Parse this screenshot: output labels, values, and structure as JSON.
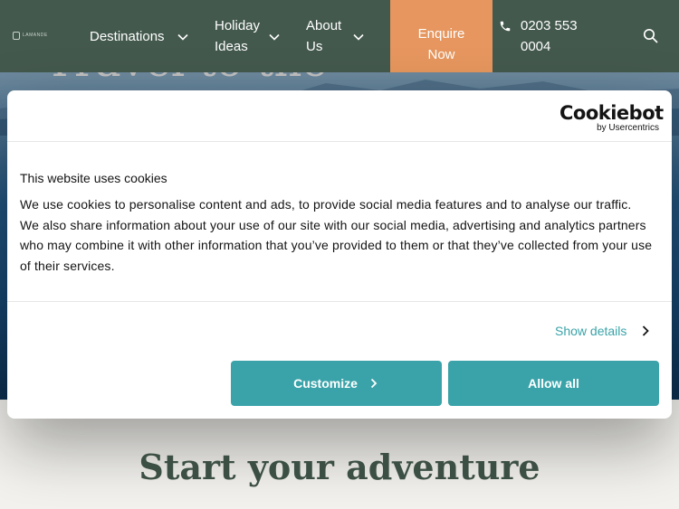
{
  "header": {
    "logo_text": "LAMANDE",
    "nav": {
      "destinations": "Destinations",
      "holiday_ideas_line1": "Holiday",
      "holiday_ideas_line2": "Ideas",
      "about_line1": "About",
      "about_line2": "Us"
    },
    "enquire_line1": "Enquire",
    "enquire_line2": "Now",
    "phone_line1": "0203 553",
    "phone_line2": "0004"
  },
  "hero": {
    "title_partial": "Travel to the"
  },
  "cookie_dialog": {
    "brand_name": "Cookiebot",
    "brand_sub": "by Usercentrics",
    "title": "This website uses cookies",
    "body": "We use cookies to personalise content and ads, to provide social media features and to analyse our traffic. We also share information about your use of our site with our social media, advertising and analytics partners who may combine it with other information that you’ve provided to them or that they’ve collected from your use of their services.",
    "show_details": "Show details",
    "customize": "Customize",
    "allow_all": "Allow all"
  },
  "main": {
    "headline": "Start your adventure"
  },
  "colors": {
    "header_bg": "#44594e",
    "enquire_bg": "#e6965e",
    "accent_teal": "#3aa3a9",
    "headline_text": "#3c4f45"
  }
}
